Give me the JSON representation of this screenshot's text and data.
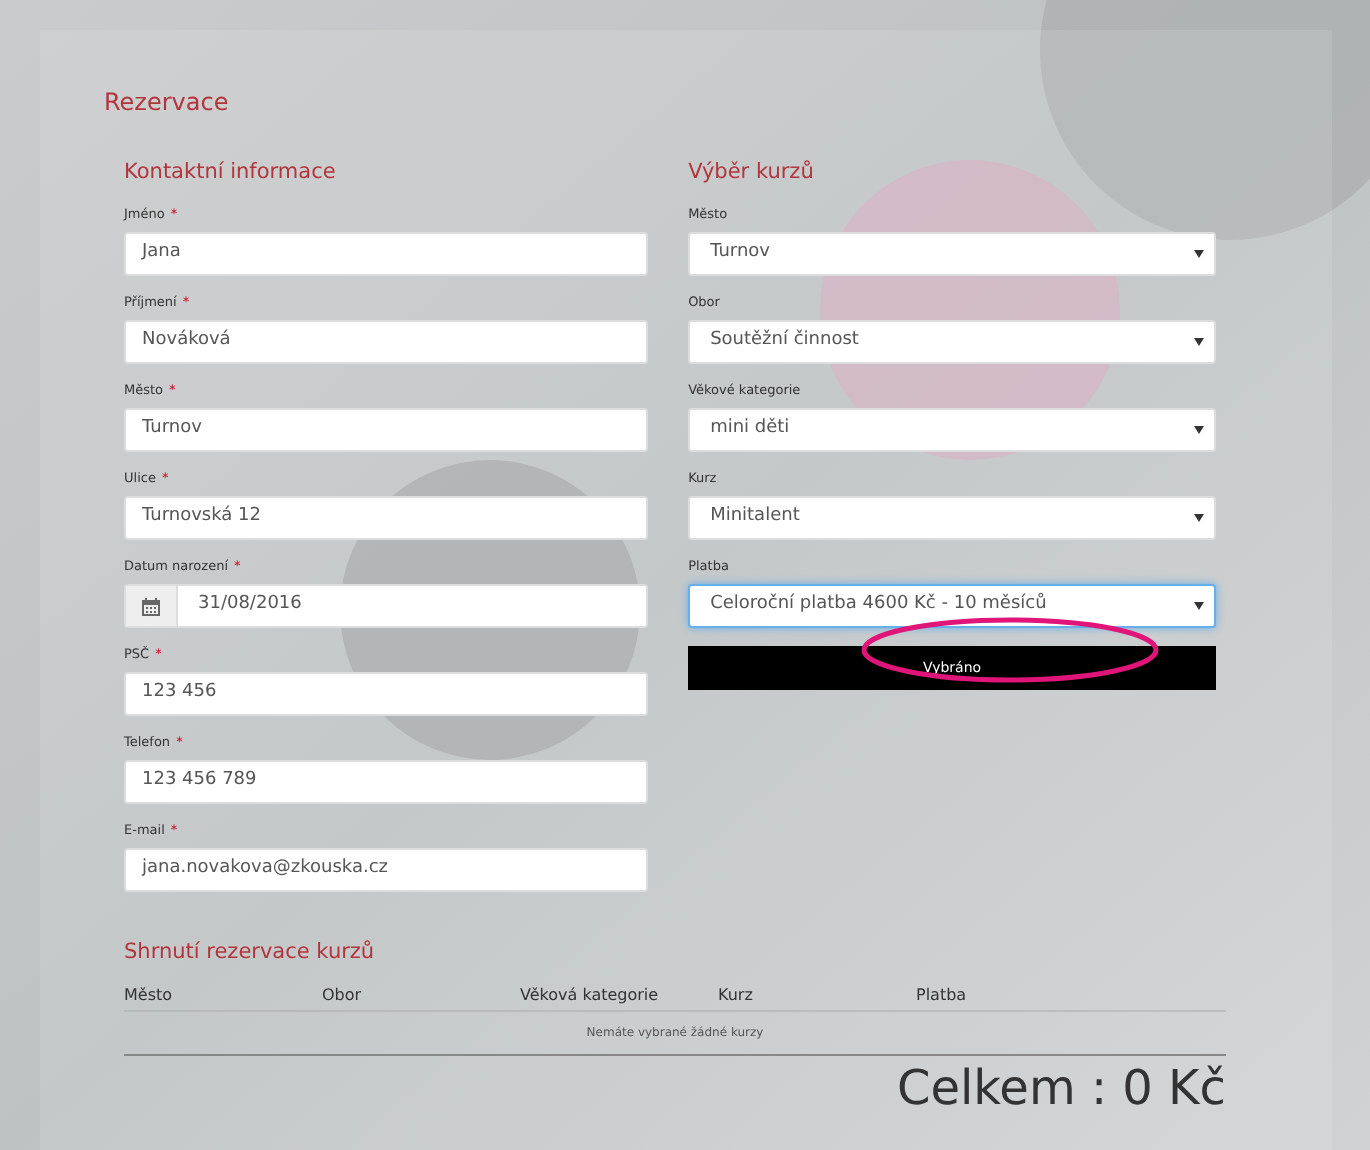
{
  "title": "Rezervace",
  "contact": {
    "heading": "Kontaktní informace",
    "fields": [
      {
        "label": "Jméno",
        "required": "*",
        "kind": "text",
        "value": "Jana"
      },
      {
        "label": "Příjmení",
        "required": "*",
        "kind": "text",
        "value": "Nováková"
      },
      {
        "label": "Město",
        "required": "*",
        "kind": "text",
        "value": "Turnov"
      },
      {
        "label": "Ulice",
        "required": "*",
        "kind": "text",
        "value": "Turnovská 12"
      },
      {
        "label": "Datum narození",
        "required": "*",
        "kind": "date",
        "value": "31/08/2016"
      },
      {
        "label": "PSČ",
        "required": "*",
        "kind": "text",
        "value": "123 456"
      },
      {
        "label": "Telefon",
        "required": "*",
        "kind": "text",
        "value": "123 456 789"
      },
      {
        "label": "E-mail",
        "required": "*",
        "kind": "text",
        "value": "jana.novakova@zkouska.cz"
      }
    ]
  },
  "course": {
    "heading": "Výběr kurzů",
    "selects": [
      {
        "label": "Město",
        "value": "Turnov",
        "focused": false
      },
      {
        "label": "Obor",
        "value": "Soutěžní činnost",
        "focused": false
      },
      {
        "label": "Věkové kategorie",
        "value": "mini děti",
        "focused": false
      },
      {
        "label": "Kurz",
        "value": "Minitalent",
        "focused": false
      },
      {
        "label": "Platba",
        "value": "Celoroční platba 4600 Kč - 10 měsíců",
        "focused": true
      }
    ],
    "button": "Vybráno"
  },
  "summary": {
    "heading": "Shrnutí rezervace kurzů",
    "columns": [
      "Město",
      "Obor",
      "Věková kategorie",
      "Kurz",
      "Platba"
    ],
    "empty_message": "Nemáte vybrané žádné kurzy",
    "total": "Celkem : 0 Kč"
  }
}
